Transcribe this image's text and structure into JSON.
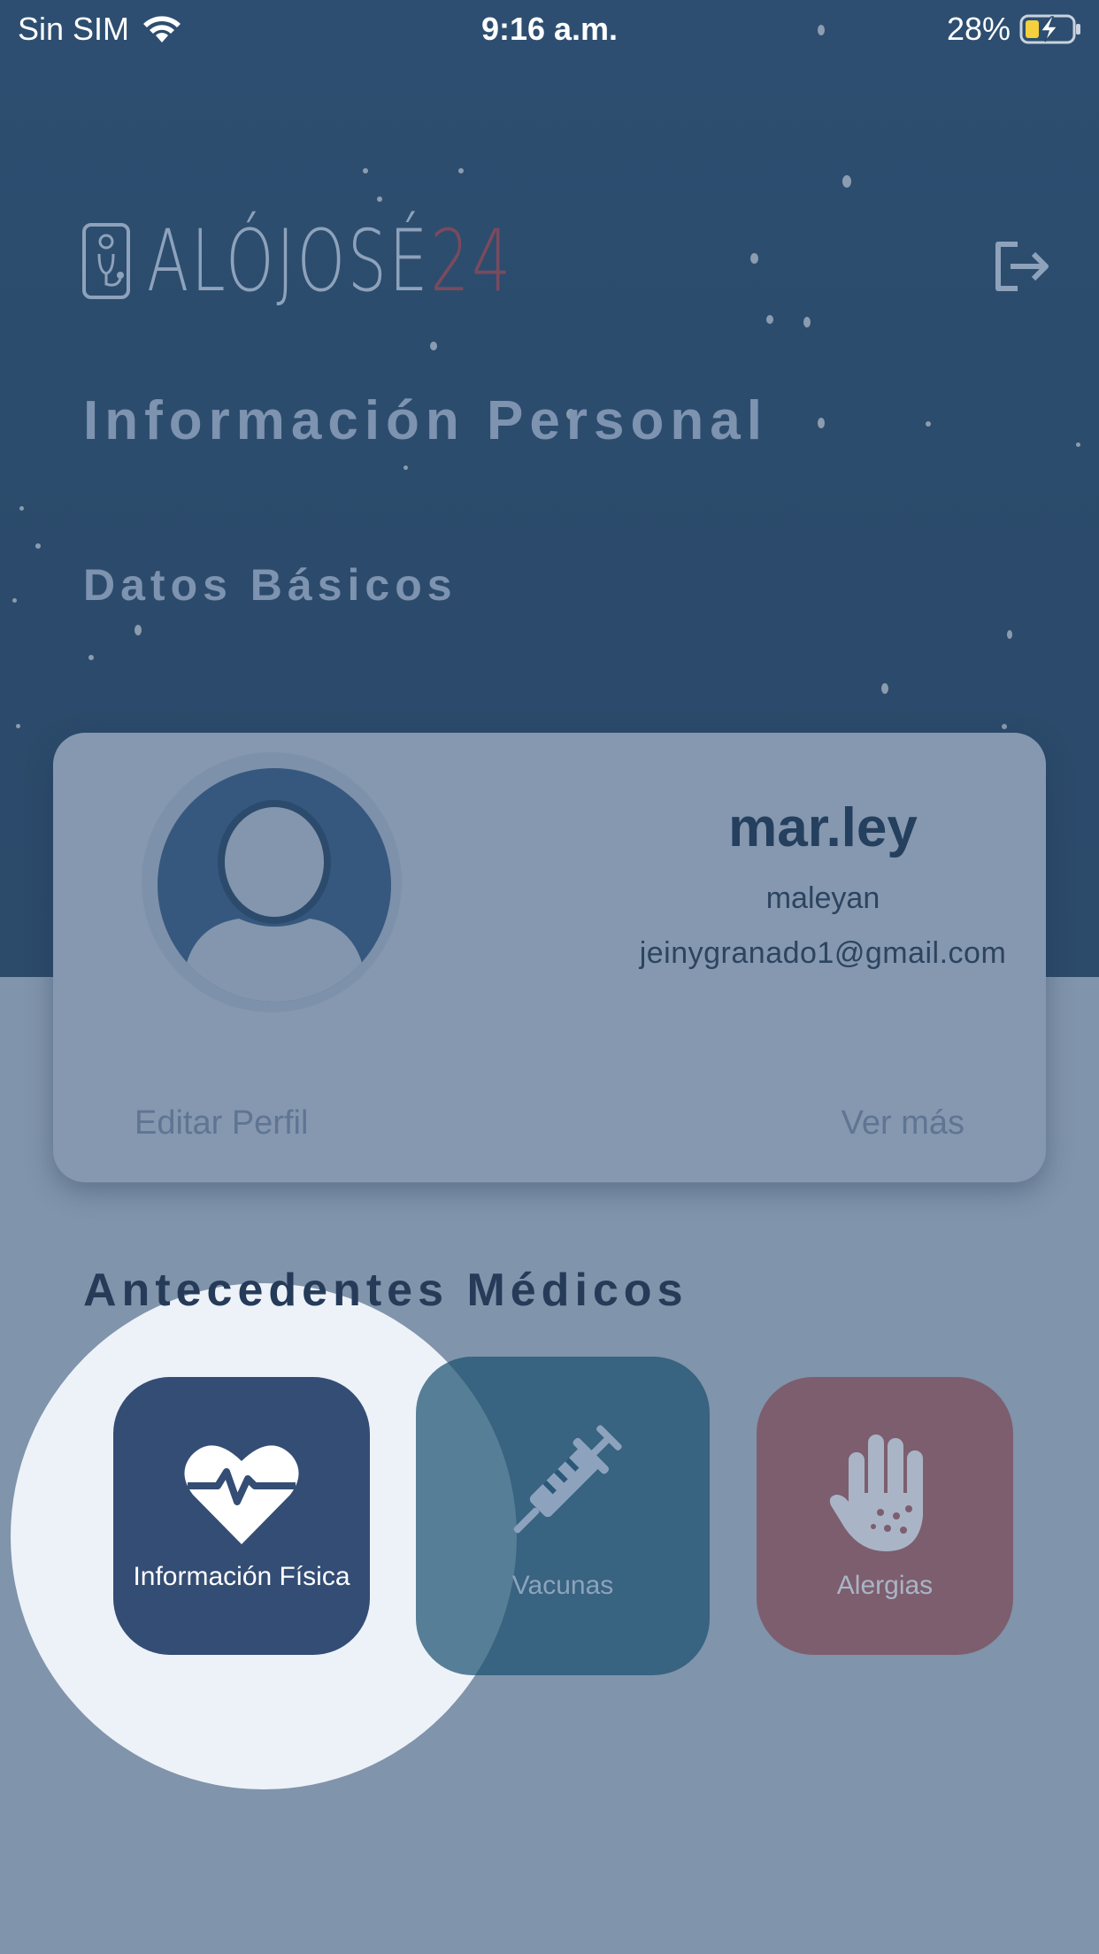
{
  "status_bar": {
    "carrier": "Sin SIM",
    "time": "9:16 a.m.",
    "battery": "28%"
  },
  "header": {
    "logo_text": "ALÓJOSÉ",
    "logo_number": "24",
    "logout_icon": "logout-icon"
  },
  "page_title": "Información Personal",
  "basic_section_title": "Datos Básicos",
  "profile": {
    "display_name": "mar.ley",
    "username": "maleyan",
    "email": "jeinygranado1@gmail.com",
    "edit_label": "Editar Perfil",
    "more_label": "Ver más",
    "avatar_icon": "user-avatar-icon"
  },
  "medical_section_title": "Antecedentes Médicos",
  "tiles": {
    "info": {
      "label": "Información Física",
      "icon": "heart-pulse-icon"
    },
    "vaccines": {
      "label": "Vacunas",
      "icon": "syringe-icon"
    },
    "allergies": {
      "label": "Alergias",
      "icon": "hand-icon"
    }
  },
  "colors": {
    "header_bg": "#2c4b6c",
    "page_bg": "#8094ab",
    "card_bg": "#8598af",
    "tile_info": "#344d74",
    "tile_vaccines": "#2c5878",
    "tile_allergies": "#7d5e6e"
  }
}
